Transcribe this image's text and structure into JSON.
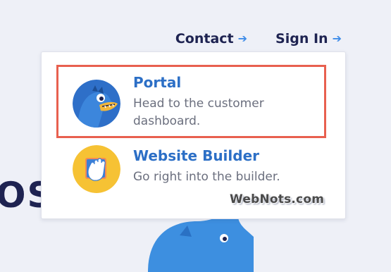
{
  "nav": {
    "contact_label": "Contact",
    "signin_label": "Sign In",
    "arrow_glyph": "➔"
  },
  "background": {
    "partial_heading": "OST"
  },
  "dropdown": {
    "items": [
      {
        "title": "Portal",
        "description": "Head to the customer dashboard.",
        "icon": "gator-mascot-icon",
        "highlighted": true
      },
      {
        "title": "Website Builder",
        "description": "Go right into the builder.",
        "icon": "builder-hand-icon",
        "highlighted": false
      }
    ]
  },
  "watermark": "WebNots.com",
  "colors": {
    "page_bg": "#eef0f7",
    "nav_text": "#1e2351",
    "arrow": "#3f8ce8",
    "item_title": "#2c6fc6",
    "item_desc": "#6b6f7e",
    "highlight_border": "#e8604f",
    "portal_icon_bg": "#2e6fc8",
    "builder_icon_bg": "#f6c234"
  }
}
